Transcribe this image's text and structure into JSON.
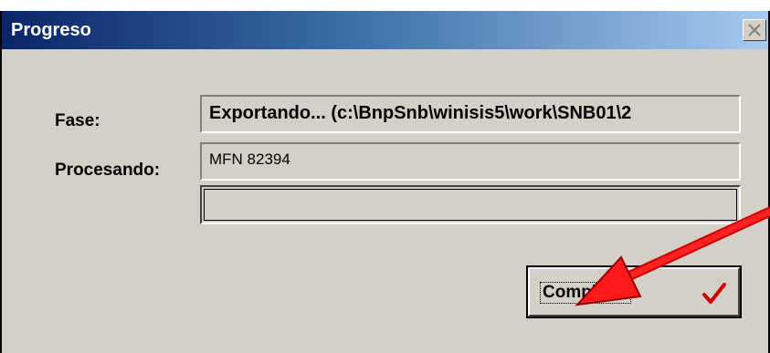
{
  "window": {
    "title": "Progreso",
    "close_icon": "close-icon"
  },
  "form": {
    "fase_label": "Fase:",
    "fase_value": "Exportando... (c:\\BnpSnb\\winisis5\\work\\SNB01\\2",
    "procesando_label": "Procesando:",
    "procesando_value": "MFN 82394"
  },
  "progress": {
    "value_fraction": 0
  },
  "button": {
    "label": "Completo!",
    "icon": "checkmark-icon",
    "icon_color": "#cc0000"
  },
  "annotation": {
    "icon": "arrow-icon",
    "color": "#ff0000"
  },
  "colors": {
    "title_gradient_start": "#0a246a",
    "title_gradient_end": "#a6caf0",
    "dialog_background": "#d4d0c8"
  }
}
